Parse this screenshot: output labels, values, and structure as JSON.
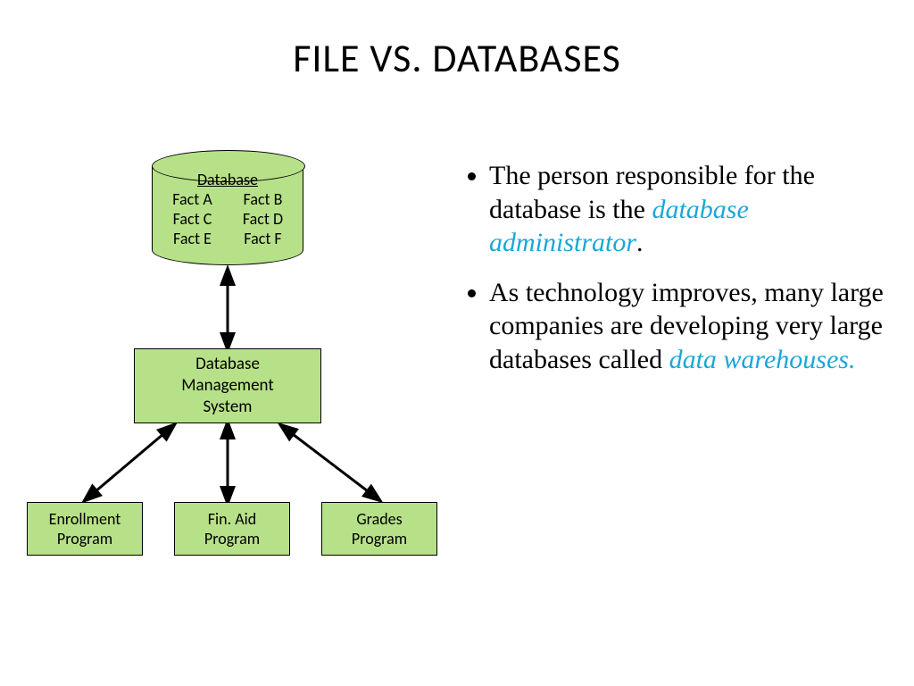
{
  "title": "FILE VS. DATABASES",
  "cylinder": {
    "heading": "Database",
    "facts": [
      "Fact A",
      "Fact B",
      "Fact C",
      "Fact D",
      "Fact E",
      "Fact F"
    ]
  },
  "dbms": {
    "line1": "Database",
    "line2": "Management",
    "line3": "System"
  },
  "programs": [
    {
      "line1": "Enrollment",
      "line2": "Program"
    },
    {
      "line1": "Fin. Aid",
      "line2": "Program"
    },
    {
      "line1": "Grades",
      "line2": "Program"
    }
  ],
  "bullets": {
    "b1a": "The person responsible for the database is the ",
    "b1b": "database administrator",
    "b1c": ".",
    "b2a": "As technology improves, many large companies are developing very large databases called ",
    "b2b": "data warehouses."
  }
}
